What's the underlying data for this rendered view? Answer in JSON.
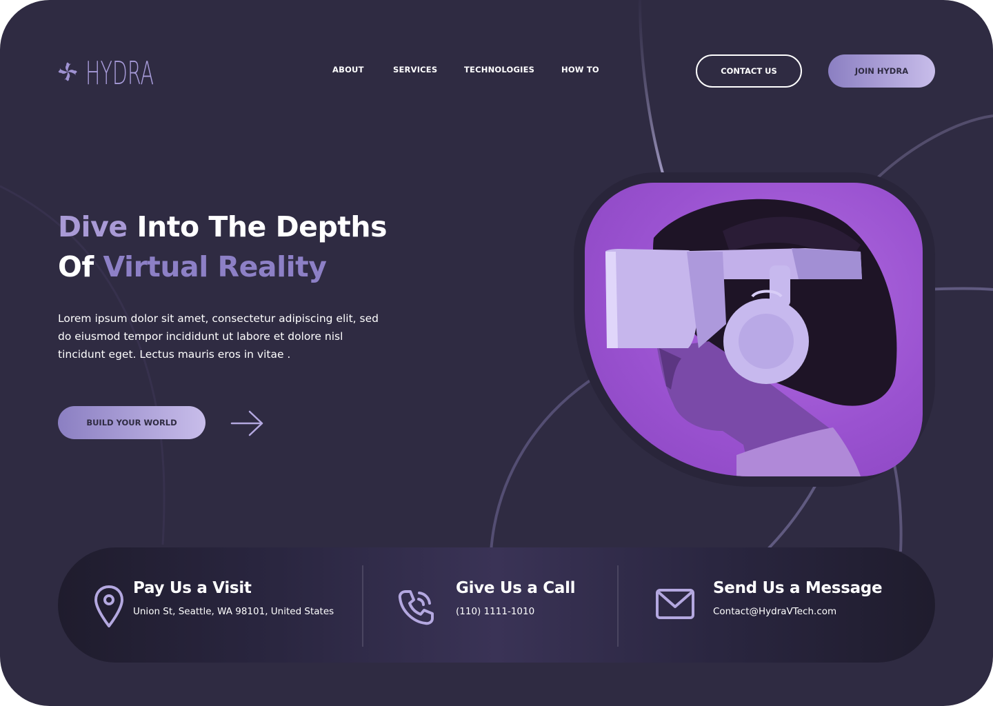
{
  "brand": {
    "name": "HYDRA",
    "accent": "#a79bd9"
  },
  "nav": {
    "items": [
      {
        "label": "ABOUT"
      },
      {
        "label": "SERVICES"
      },
      {
        "label": "TECHNOLOGIES"
      },
      {
        "label": "HOW TO"
      }
    ]
  },
  "header": {
    "contact_label": "CONTACT US",
    "join_label": "JOIN HYDRA"
  },
  "hero": {
    "title_part1": "Dive",
    "title_part2": " Into The Depths",
    "title_part3": "Of ",
    "title_part4": "Virtual Reality",
    "description": "Lorem ipsum dolor sit amet, consectetur adipiscing elit, sed do eiusmod tempor incididunt ut labore et dolore nisl tincidunt eget. Lectus mauris eros in vitae .",
    "cta_label": "BUILD YOUR WORLD",
    "arrow_icon": "arrow-right-icon",
    "image_icon": "vr-headset-person-image"
  },
  "contact": {
    "items": [
      {
        "title": "Pay Us a Visit",
        "detail": "Union St, Seattle, WA 98101, United States",
        "icon": "location-pin-icon"
      },
      {
        "title": "Give Us a Call",
        "detail": "(110) 1111-1010",
        "icon": "phone-icon"
      },
      {
        "title": "Send Us a Message",
        "detail": "Contact@HydraVTech.com",
        "icon": "mail-icon"
      }
    ]
  },
  "colors": {
    "background": "#2f2b42",
    "accent_light": "#c8bdea",
    "accent": "#8b7fc2",
    "image_purple": "#9a52d0"
  }
}
